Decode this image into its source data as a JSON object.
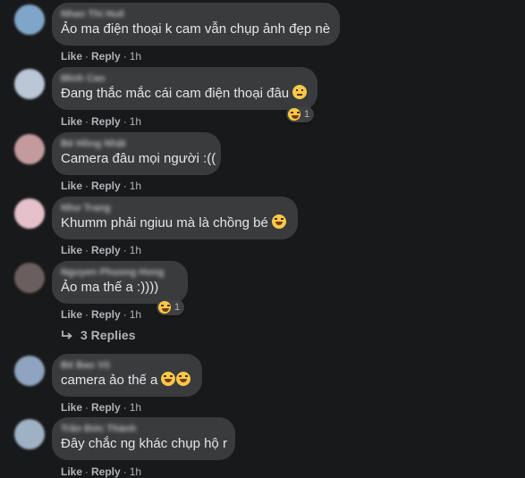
{
  "comments": [
    {
      "author": "Nhan Thi Huế",
      "text": "Ảo ma điện thoại k cam vẫn chụp ảnh đẹp nè",
      "emojis": [],
      "like": "Like",
      "reply": "Reply",
      "time": "1h",
      "avatar_color": "#7fa6c8"
    },
    {
      "author": "Minh Cao",
      "text": "Đang thắc mắc cái cam điện thoại đâu",
      "emojis": [
        "worried"
      ],
      "like": "Like",
      "reply": "Reply",
      "time": "1h",
      "reaction": {
        "emoji": "laughing",
        "count": "1"
      },
      "avatar_color": "#b9c7d6"
    },
    {
      "author": "Bé Hồng Nhật",
      "text": "Camera đâu mọi người :((",
      "emojis": [],
      "like": "Like",
      "reply": "Reply",
      "time": "1h",
      "avatar_color": "#c39b9e"
    },
    {
      "author": "Như Trang",
      "text": "Khumm phải ngiuu mà là chồng bé",
      "emojis": [
        "grin"
      ],
      "like": "Like",
      "reply": "Reply",
      "time": "1h",
      "avatar_color": "#e4c1cb"
    },
    {
      "author": "Nguyen Phuong Hong",
      "text": "Ảo ma thế a :))))",
      "emojis": [],
      "like": "Like",
      "reply": "Reply",
      "time": "1h",
      "reaction": {
        "emoji": "laughing",
        "count": "1"
      },
      "avatar_color": "#6a5f5c"
    },
    {
      "author": "Bé Bao Vũ",
      "text": "camera ảo thế a",
      "emojis": [
        "laughing",
        "laughing"
      ],
      "like": "Like",
      "reply": "Reply",
      "time": "1h",
      "avatar_color": "#8ea4bf"
    },
    {
      "author": "Trần Đức Thành",
      "text": "Đây chắc ng khác chụp hộ r",
      "emojis": [],
      "like": "Like",
      "reply": "Reply",
      "time": "1h",
      "avatar_color": "#9fb1c4"
    }
  ],
  "replies_link": "3 Replies",
  "colors": {
    "background": "#18191a",
    "bubble": "#3a3b3c",
    "text": "#e4e6eb",
    "muted": "#b0b3b8"
  }
}
